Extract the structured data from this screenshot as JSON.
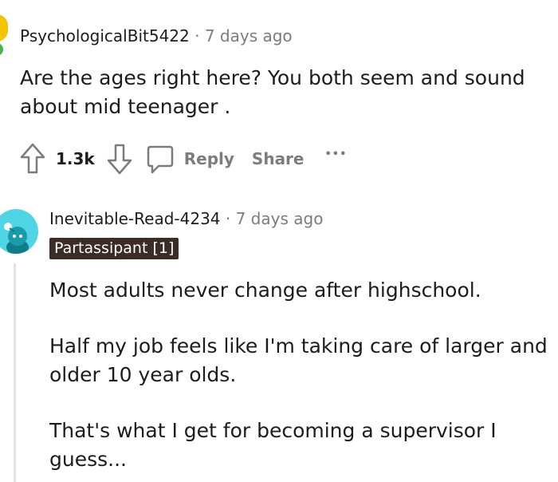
{
  "comment1": {
    "username": "PsychologicalBit5422",
    "separator": "·",
    "time": "7 days ago",
    "text": "Are the ages right here? You both seem and sound about mid teenager .",
    "votes": "1.3k",
    "reply_label": "Reply",
    "share_label": "Share",
    "more_label": "•••",
    "avatar_colors": [
      "#f5c400",
      "#45b649"
    ]
  },
  "comment2": {
    "username": "Inevitable-Read-4234",
    "separator": "·",
    "time": "7 days ago",
    "flair": "Partassipant [1]",
    "paragraphs": [
      "Most adults never change after highschool.",
      "Half my job feels like I'm taking care of larger and older 10 year olds.",
      "That's what I get for becoming a supervisor I guess..."
    ],
    "avatar_color": "#4fd6e6"
  }
}
